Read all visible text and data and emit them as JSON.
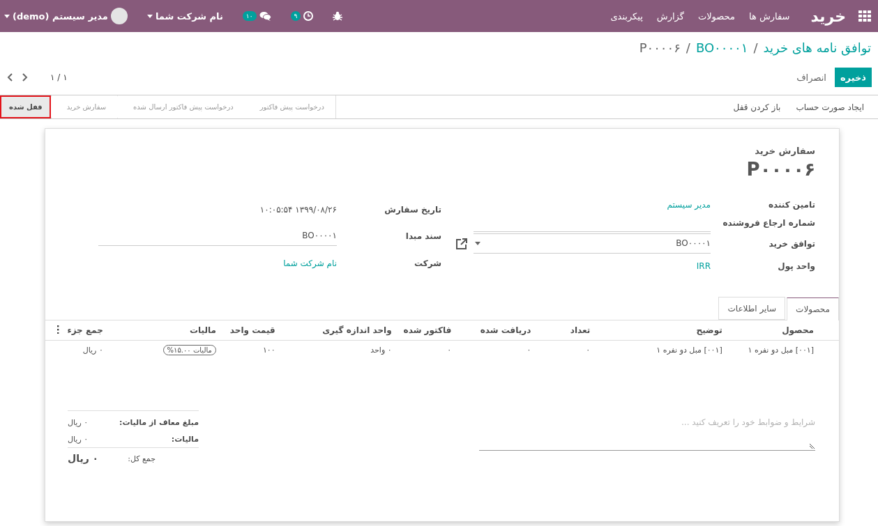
{
  "navbar": {
    "app_title": "خرید",
    "menu": [
      "سفارش ها",
      "محصولات",
      "گزارش",
      "پیکربندی"
    ],
    "activity_count": "۹",
    "message_count": "۱۰",
    "company": "نام شرکت شما",
    "user": "مدیر سیستم (demo)"
  },
  "breadcrumbs": [
    {
      "label": "توافق نامه های خرید",
      "link": true
    },
    {
      "label": "BO۰۰۰۰۱",
      "link": true
    },
    {
      "label": "P۰۰۰۰۶",
      "link": false
    }
  ],
  "breadcrumb_separator": "/",
  "buttons": {
    "save": "ذخیره",
    "discard": "انصراف"
  },
  "pager": "۱ / ۱",
  "actions": [
    "ایجاد صورت حساب",
    "باز کردن قفل"
  ],
  "stages": [
    {
      "label": "درخواست پیش فاکتور",
      "selected": false,
      "highlight": false
    },
    {
      "label": "درخواست پیش فاکتور ارسال شده",
      "selected": false,
      "highlight": false
    },
    {
      "label": "سفارش خرید",
      "selected": false,
      "highlight": false
    },
    {
      "label": "قفل شده",
      "selected": true,
      "highlight": true
    }
  ],
  "form": {
    "title_label": "سفارش خرید",
    "name": "P۰۰۰۰۶",
    "right_fields": [
      {
        "label": "تامین کننده",
        "value": "مدیر سیستم",
        "kind": "link"
      },
      {
        "label": "شماره ارجاع فروشنده",
        "kind": "empty"
      },
      {
        "label": "توافق خرید",
        "value": "BO۰۰۰۰۱",
        "kind": "select"
      },
      {
        "label": "واحد پول",
        "value": "IRR",
        "kind": "link"
      }
    ],
    "left_fields": [
      {
        "label": "تاریخ سفارش",
        "value": "۱۳۹۹/۰۸/۲۶ ۱۰:۰۵:۵۴",
        "kind": "text"
      },
      {
        "label": "سند مبدا",
        "value": "BO۰۰۰۰۱",
        "kind": "input"
      },
      {
        "label": "شرکت",
        "value": "نام شرکت شما",
        "kind": "link"
      }
    ]
  },
  "tabs": [
    {
      "label": "محصولات",
      "selected": true
    },
    {
      "label": "سایر اطلاعات",
      "selected": false
    }
  ],
  "table": {
    "columns": [
      {
        "label": "محصول",
        "kind": "text"
      },
      {
        "label": "توضیح",
        "kind": "text"
      },
      {
        "label": "تعداد",
        "kind": "text"
      },
      {
        "label": "دریافت شده",
        "kind": "text"
      },
      {
        "label": "فاکتور شده",
        "kind": "text"
      },
      {
        "label": "واحد اندازه گیری",
        "kind": "text"
      },
      {
        "label": "قیمت واحد",
        "kind": "text"
      },
      {
        "label": "مالیات",
        "kind": "tag"
      },
      {
        "label": "جمع جزء",
        "kind": "text"
      }
    ],
    "rows": [
      {
        "cells": [
          "[۰۰۱] مبل دو نفره ۱",
          "[۰۰۱] مبل دو نفره ۱",
          "۰",
          "۰",
          "۰",
          "۰ واحد",
          "۱۰۰",
          "مالیات ۱۵.۰۰%",
          "۰ ریال"
        ]
      }
    ]
  },
  "notes": {
    "placeholder": "شرایط و ضوابط خود را تعریف کنید ..."
  },
  "totals": [
    {
      "label": "مبلغ معاف از مالیات:",
      "value": "۰ ریال",
      "kind": "line"
    },
    {
      "label": "مالیات:",
      "value": "۰ ریال",
      "kind": "line"
    },
    {
      "label": "جمع کل:",
      "value": "۰ ریال",
      "kind": "total"
    }
  ]
}
